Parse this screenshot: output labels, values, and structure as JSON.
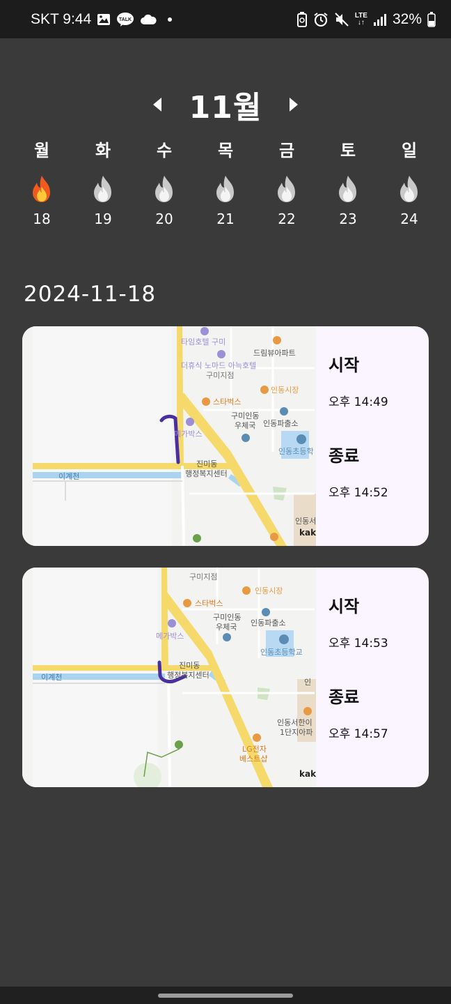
{
  "status": {
    "carrier_time": "SKT 9:44",
    "battery": "32%",
    "lte": "LTE"
  },
  "calendar": {
    "month_label": "11월",
    "days": [
      {
        "dow": "월",
        "date": "18",
        "active": true
      },
      {
        "dow": "화",
        "date": "19",
        "active": false
      },
      {
        "dow": "수",
        "date": "20",
        "active": false
      },
      {
        "dow": "목",
        "date": "21",
        "active": false
      },
      {
        "dow": "금",
        "date": "22",
        "active": false
      },
      {
        "dow": "토",
        "date": "23",
        "active": false
      },
      {
        "dow": "일",
        "date": "24",
        "active": false
      }
    ]
  },
  "selected_date": "2024-11-18",
  "records": [
    {
      "start_label": "시작",
      "start_time": "오후 14:49",
      "end_label": "종료",
      "end_time": "오후 14:52",
      "map_labels": {
        "hotel": "타임호텔 구미",
        "apt": "드림뷰아파트",
        "hotel2": "더휴식 노마드 아늑호텔",
        "branch": "구미지점",
        "market": "인동시장",
        "starbucks": "스타벅스",
        "post1": "구미인동",
        "post2": "우체국",
        "police": "인동파출소",
        "megabox": "메가박스",
        "school": "인동초등학",
        "center1": "진미동",
        "center2": "행정복지센터",
        "stream": "이계천",
        "bottom": "인동서",
        "kakao": "kaka"
      }
    },
    {
      "start_label": "시작",
      "start_time": "오후 14:53",
      "end_label": "종료",
      "end_time": "오후 14:57",
      "map_labels": {
        "branch": "구미지점",
        "market": "인동시장",
        "starbucks": "스타벅스",
        "post1": "구미인동",
        "post2": "우체국",
        "police": "인동파출소",
        "megabox": "메가박스",
        "school": "인동초등학교",
        "center1": "진미동",
        "center2": "행정복지센터",
        "stream": "이계천",
        "apt1": "인동서한이",
        "apt2": "1단지아파",
        "lg1": "LG전자",
        "lg2": "베스트샵",
        "right": "인",
        "kakao": "kaka"
      }
    }
  ],
  "colors": {
    "background": "#3a3a3a",
    "card": "#fbf5ff",
    "route": "#4a2fa0",
    "road": "#f6d96b",
    "water": "#a9d3ee"
  }
}
